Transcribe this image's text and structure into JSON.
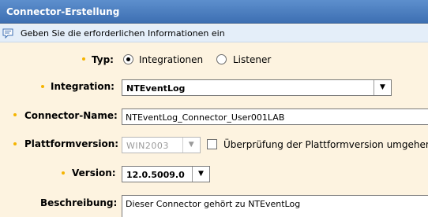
{
  "window": {
    "title": "Connector-Erstellung"
  },
  "info": {
    "icon": "speech-bubble-icon",
    "message": "Geben Sie die erforderlichen Informationen ein"
  },
  "form": {
    "typ": {
      "label": "Typ:",
      "options": [
        {
          "label": "Integrationen",
          "selected": true
        },
        {
          "label": "Listener",
          "selected": false
        }
      ]
    },
    "integration": {
      "label": "Integration:",
      "value": "NTEventLog"
    },
    "connector_name": {
      "label": "Connector-Name:",
      "value": "NTEventLog_Connector_User001LAB"
    },
    "plattformversion": {
      "label": "Plattformversion:",
      "value": "WIN2003",
      "disabled": true,
      "check_label": "Überprüfung der Plattformversion umgehen",
      "checked": false
    },
    "version": {
      "label": "Version:",
      "value": "12.0.5009.0"
    },
    "beschreibung": {
      "label": "Beschreibung:",
      "value": "Dieser Connector gehört zu NTEventLog"
    }
  },
  "colors": {
    "titlebar": "#3d6fb2",
    "infobar": "#e4eef9",
    "form_bg": "#fdf3e0",
    "required_dot": "#f5b400"
  }
}
